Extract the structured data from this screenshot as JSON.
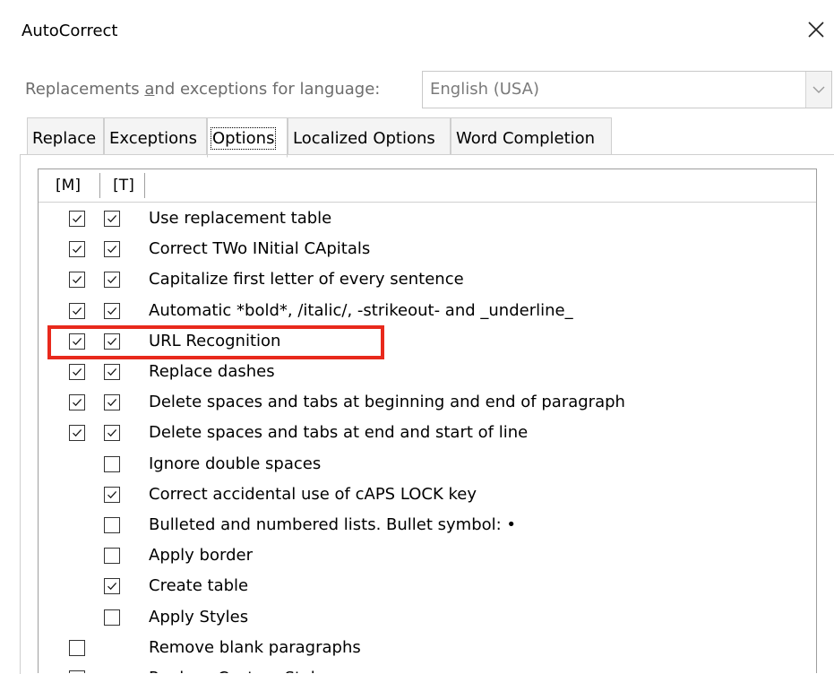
{
  "window": {
    "title": "AutoCorrect"
  },
  "language": {
    "label_before": "Replacements ",
    "label_accel": "a",
    "label_after": "nd exceptions for language:",
    "selected": "English (USA)"
  },
  "tabs": [
    {
      "label": "Replace"
    },
    {
      "label": "Exceptions"
    },
    {
      "label": "Options",
      "active": true
    },
    {
      "label": "Localized Options"
    },
    {
      "label": "Word Completion"
    }
  ],
  "columns": {
    "m": "[M]",
    "t": "[T]"
  },
  "options": [
    {
      "label": "Use replacement table",
      "m": true,
      "t": true
    },
    {
      "label": "Correct TWo INitial CApitals",
      "m": true,
      "t": true
    },
    {
      "label": "Capitalize first letter of every sentence",
      "m": true,
      "t": true
    },
    {
      "label": "Automatic *bold*, /italic/, -strikeout- and _underline_",
      "m": true,
      "t": true
    },
    {
      "label": "URL Recognition",
      "m": true,
      "t": true,
      "highlighted": true
    },
    {
      "label": "Replace dashes",
      "m": true,
      "t": true
    },
    {
      "label": "Delete spaces and tabs at beginning and end of paragraph",
      "m": true,
      "t": true
    },
    {
      "label": "Delete spaces and tabs at end and start of line",
      "m": true,
      "t": true
    },
    {
      "label": "Ignore double spaces",
      "m": null,
      "t": false
    },
    {
      "label": "Correct accidental use of cAPS LOCK key",
      "m": null,
      "t": true
    },
    {
      "label": "Bulleted and numbered lists. Bullet symbol: •",
      "m": null,
      "t": false
    },
    {
      "label": "Apply border",
      "m": null,
      "t": false
    },
    {
      "label": "Create table",
      "m": null,
      "t": true
    },
    {
      "label": "Apply Styles",
      "m": null,
      "t": false
    },
    {
      "label": "Remove blank paragraphs",
      "m": false,
      "t": null
    },
    {
      "label": "Replace Custom Styles",
      "m": true,
      "t": null
    }
  ],
  "highlight_color": "#e8291c"
}
